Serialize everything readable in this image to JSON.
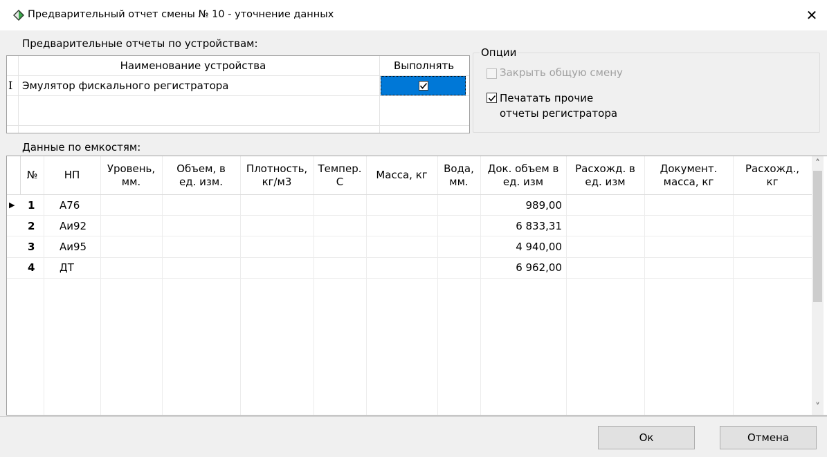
{
  "window": {
    "title": "Предварительный отчет смены № 10 - уточнение данных",
    "close_glyph": "✕"
  },
  "devices": {
    "section_label": "Предварительные отчеты по устройствам:",
    "col_name": "Наименование устройства",
    "col_exec": "Выполнять",
    "row_marker": "I",
    "rows": [
      {
        "name": "Эмулятор фискального регистратора",
        "execute": true
      }
    ]
  },
  "options": {
    "label": "Опции",
    "close_shift": {
      "label": "Закрыть общую смену",
      "checked": false,
      "enabled": false
    },
    "print_other": {
      "line1": "Печатать прочие",
      "line2": "отчеты регистратора",
      "checked": true
    }
  },
  "tanks": {
    "section_label": "Данные по емкостям:",
    "headers": {
      "num": "№",
      "np": "НП",
      "level_1": "Уровень,",
      "level_2": "мм.",
      "volume_1": "Объем, в",
      "volume_2": "ед. изм.",
      "density_1": "Плотность,",
      "density_2": "кг/м3",
      "temp_1": "Темпер.",
      "temp_2": "С",
      "mass": "Масса, кг",
      "water_1": "Вода,",
      "water_2": "мм.",
      "docvol_1": "Док. объем в",
      "docvol_2": "ед. изм",
      "diff_1": "Расхожд. в",
      "diff_2": "ед. изм",
      "docmass_1": "Документ.",
      "docmass_2": "масса, кг",
      "diffkg_1": "Расхожд.,",
      "diffkg_2": "кг"
    },
    "rows": [
      {
        "num": "1",
        "np": "А76",
        "doc_volume": "989,00"
      },
      {
        "num": "2",
        "np": "Аи92",
        "doc_volume": "6 833,31"
      },
      {
        "num": "3",
        "np": "Аи95",
        "doc_volume": "4 940,00"
      },
      {
        "num": "4",
        "np": "ДТ",
        "doc_volume": "6 962,00"
      }
    ],
    "current_row_glyph": "▶",
    "scroll_up": "˄",
    "scroll_down": "˅"
  },
  "buttons": {
    "ok": "Ок",
    "cancel": "Отмена"
  }
}
